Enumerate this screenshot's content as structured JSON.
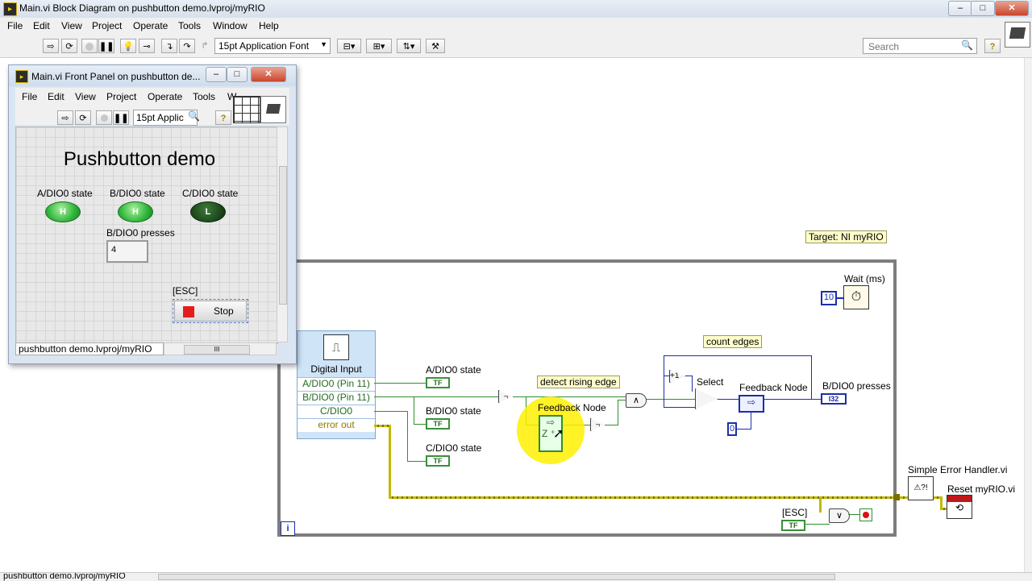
{
  "window": {
    "title": "Main.vi Block Diagram on pushbutton demo.lvproj/myRIO",
    "minimize": "–",
    "maximize": "□",
    "close": "✕"
  },
  "menu": [
    "File",
    "Edit",
    "View",
    "Project",
    "Operate",
    "Tools",
    "Window",
    "Help"
  ],
  "toolbar": {
    "font_select": "15pt Application Font",
    "search_placeholder": "Search",
    "help": "?"
  },
  "front_panel": {
    "title": "Main.vi Front Panel on pushbutton de...",
    "menu": [
      "File",
      "Edit",
      "View",
      "Project",
      "Operate",
      "Tools",
      "W"
    ],
    "font_select": "15pt Applic",
    "help": "?",
    "heading": "Pushbutton demo",
    "leds": [
      {
        "label": "A/DIO0 state",
        "text": "H"
      },
      {
        "label": "B/DIO0 state",
        "text": "H"
      },
      {
        "label": "C/DIO0 state",
        "text": "L"
      }
    ],
    "presses_label": "B/DIO0 presses",
    "presses_value": "4",
    "esc_label": "[ESC]",
    "stop_label": "Stop",
    "path": "pushbutton demo.lvproj/myRIO",
    "scroll_mid": "III"
  },
  "diagram": {
    "target_note": "Target: NI myRIO",
    "wait_label": "Wait (ms)",
    "wait_value": "10",
    "digital_input": {
      "title": "Digital Input",
      "rows": [
        "A/DIO0 (Pin 11)",
        "B/DIO0 (Pin 11)",
        "C/DIO0",
        "error out"
      ]
    },
    "indicators": [
      "A/DIO0 state",
      "B/DIO0 state",
      "C/DIO0 state"
    ],
    "tf": "TF",
    "detect_note": "detect rising edge",
    "count_note": "count edges",
    "feedback1": "Feedback Node",
    "feedback2": "Feedback Node",
    "select": "Select",
    "presses_label": "B/DIO0 presses",
    "i32": "I32",
    "zero": "0",
    "esc": "[ESC]",
    "error_handler": "Simple Error Handler.vi",
    "reset": "Reset myRIO.vi",
    "iteration": "i",
    "and_symbol": "∧",
    "or_symbol": "∨",
    "not_symbol": "¬"
  },
  "status": {
    "path": "pushbutton demo.lvproj/myRIO"
  }
}
